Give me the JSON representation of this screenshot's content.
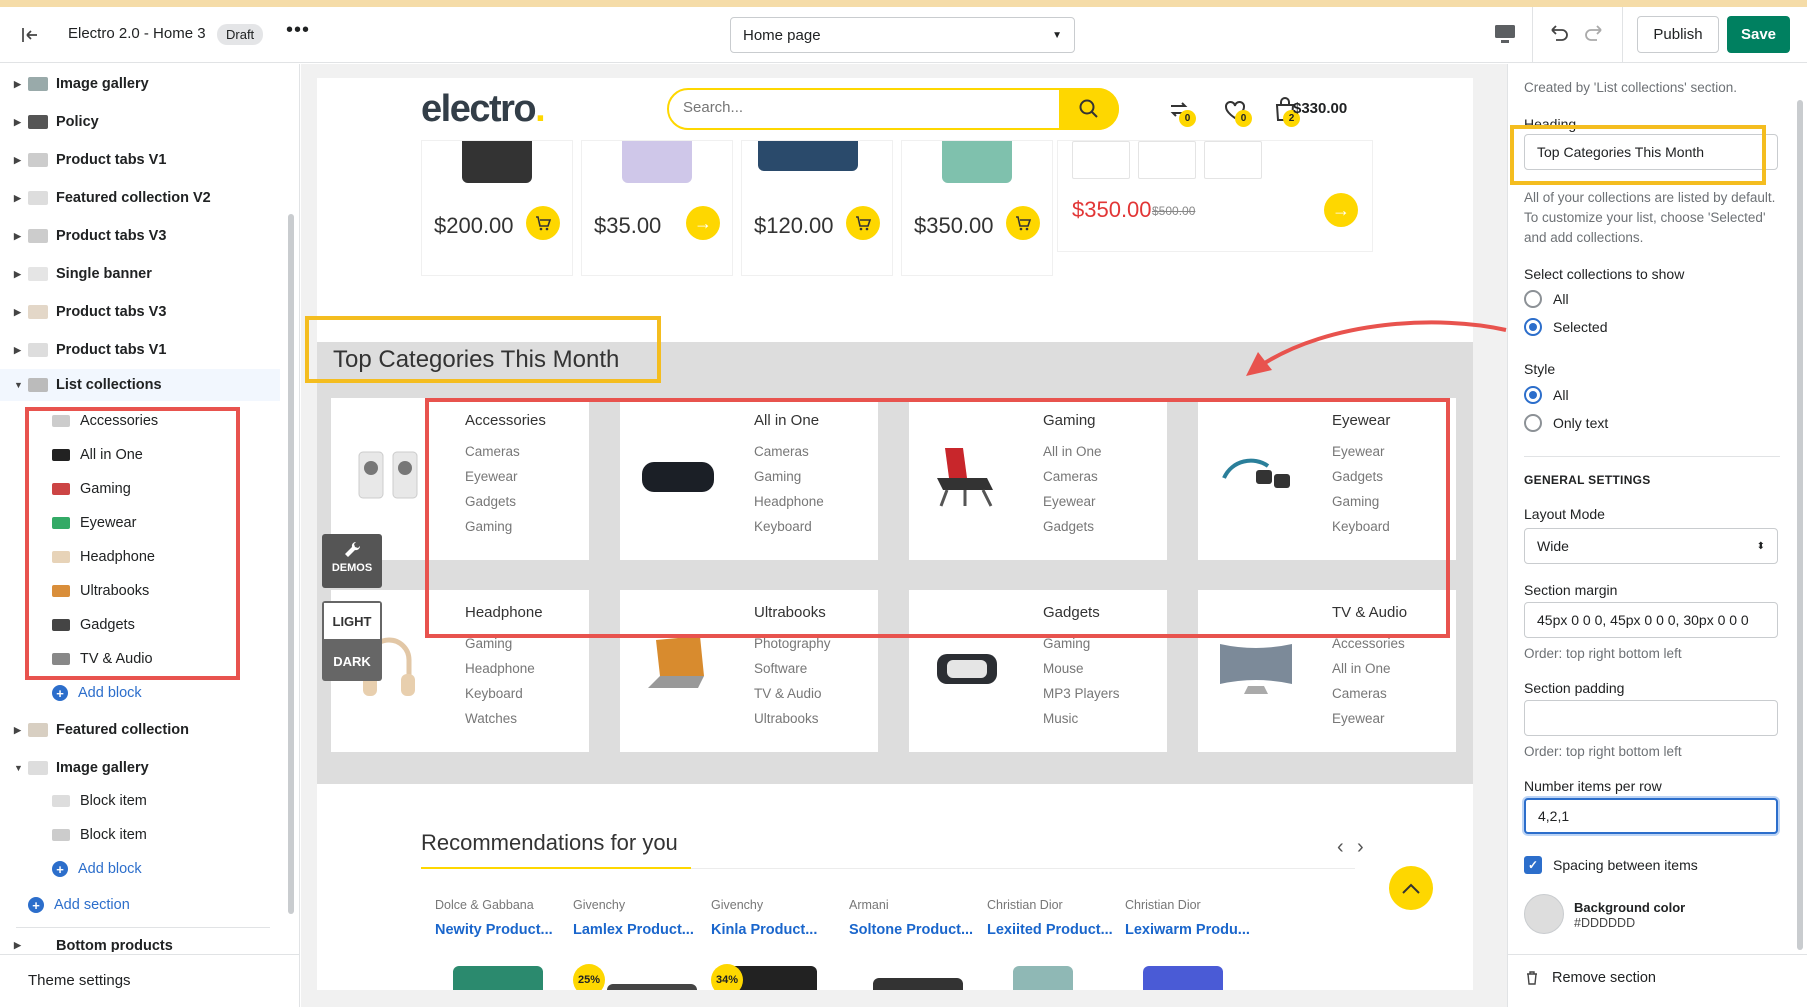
{
  "topbar": {
    "title": "Electro 2.0 - Home 3",
    "status": "Draft",
    "template_select": "Home page",
    "publish_label": "Publish",
    "save_label": "Save",
    "colors": {
      "save": "#008060"
    }
  },
  "sidebar": {
    "sections": [
      {
        "label": "Image gallery",
        "expanded": false
      },
      {
        "label": "Policy",
        "expanded": false
      },
      {
        "label": "Product tabs V1",
        "expanded": false
      },
      {
        "label": "Featured collection V2",
        "expanded": false
      },
      {
        "label": "Product tabs V3",
        "expanded": false
      },
      {
        "label": "Single banner",
        "expanded": false
      },
      {
        "label": "Product tabs V3",
        "expanded": false
      },
      {
        "label": "Product tabs V1",
        "expanded": false
      },
      {
        "label": "List collections",
        "expanded": true,
        "active": true
      }
    ],
    "list_collection_blocks": [
      "Accessories",
      "All in One",
      "Gaming",
      "Eyewear",
      "Headphone",
      "Ultrabooks",
      "Gadgets",
      "TV & Audio"
    ],
    "add_block_label": "Add block",
    "sections_after": [
      {
        "label": "Featured collection",
        "expanded": false
      },
      {
        "label": "Image gallery",
        "expanded": true
      }
    ],
    "gallery_blocks": [
      "Block item",
      "Block item"
    ],
    "add_section_label": "Add section",
    "cut_off_item": "Bottom products",
    "footer_label": "Theme settings"
  },
  "preview": {
    "logo": "electro",
    "search_placeholder": "Search...",
    "compare_count": "0",
    "wishlist_count": "0",
    "cart_count": "2",
    "cart_total": "$330.00",
    "products": [
      {
        "price": "$200.00",
        "button": "cart"
      },
      {
        "price": "$35.00",
        "button": "arrow"
      },
      {
        "price": "$120.00",
        "button": "cart"
      },
      {
        "price": "$350.00",
        "button": "cart"
      }
    ],
    "featured": {
      "price": "$350.00",
      "old_price": "$500.00"
    },
    "category_heading": "Top Categories This Month",
    "categories": [
      {
        "title": "Accessories",
        "items": [
          "Cameras",
          "Eyewear",
          "Gadgets",
          "Gaming"
        ]
      },
      {
        "title": "All in One",
        "items": [
          "Cameras",
          "Gaming",
          "Headphone",
          "Keyboard"
        ]
      },
      {
        "title": "Gaming",
        "items": [
          "All in One",
          "Cameras",
          "Eyewear",
          "Gadgets"
        ]
      },
      {
        "title": "Eyewear",
        "items": [
          "Eyewear",
          "Gadgets",
          "Gaming",
          "Keyboard"
        ]
      },
      {
        "title": "Headphone",
        "items": [
          "Gaming",
          "Headphone",
          "Keyboard",
          "Watches"
        ]
      },
      {
        "title": "Ultrabooks",
        "items": [
          "Photography",
          "Software",
          "TV & Audio",
          "Ultrabooks"
        ]
      },
      {
        "title": "Gadgets",
        "items": [
          "Gaming",
          "Mouse",
          "MP3 Players",
          "Music"
        ]
      },
      {
        "title": "TV & Audio",
        "items": [
          "Accessories",
          "All in One",
          "Cameras",
          "Eyewear"
        ]
      }
    ],
    "demos_label": "DEMOS",
    "light_label": "LIGHT",
    "dark_label": "DARK",
    "recommendations_title": "Recommendations for you",
    "recommendations": [
      {
        "brand": "Dolce & Gabbana",
        "name": "Newity Product..."
      },
      {
        "brand": "Givenchy",
        "name": "Lamlex Product...",
        "discount": "25%"
      },
      {
        "brand": "Givenchy",
        "name": "Kinla Product...",
        "discount": "34%"
      },
      {
        "brand": "Armani",
        "name": "Soltone Product..."
      },
      {
        "brand": "Christian Dior",
        "name": "Lexiited Product..."
      },
      {
        "brand": "Christian Dior",
        "name": "Lexiwarm Produ..."
      }
    ],
    "colors": {
      "accent": "#fed700",
      "section_bg": "#dddddd",
      "link": "#1a66cc",
      "sale": "#e23636"
    }
  },
  "settings": {
    "created_by": "Created by 'List collections' section.",
    "heading_label": "Heading",
    "heading_value": "Top Categories This Month",
    "collections_help": "All of your collections are listed by default. To customize your list, choose 'Selected' and add collections.",
    "select_label": "Select collections to show",
    "select_options": [
      "All",
      "Selected"
    ],
    "select_value": "Selected",
    "style_label": "Style",
    "style_options": [
      "All",
      "Only text"
    ],
    "style_value": "All",
    "general_heading": "GENERAL SETTINGS",
    "layout_mode_label": "Layout Mode",
    "layout_mode_value": "Wide",
    "margin_label": "Section margin",
    "margin_value": "45px 0 0 0, 45px 0 0 0, 30px 0 0 0",
    "margin_help": "Order: top right bottom left",
    "padding_label": "Section padding",
    "padding_value": "",
    "padding_help": "Order: top right bottom left",
    "items_per_row_label": "Number items per row",
    "items_per_row_value": "4,2,1",
    "spacing_label": "Spacing between items",
    "spacing_checked": true,
    "bg_label": "Background color",
    "bg_value": "#DDDDDD",
    "remove_label": "Remove section"
  }
}
